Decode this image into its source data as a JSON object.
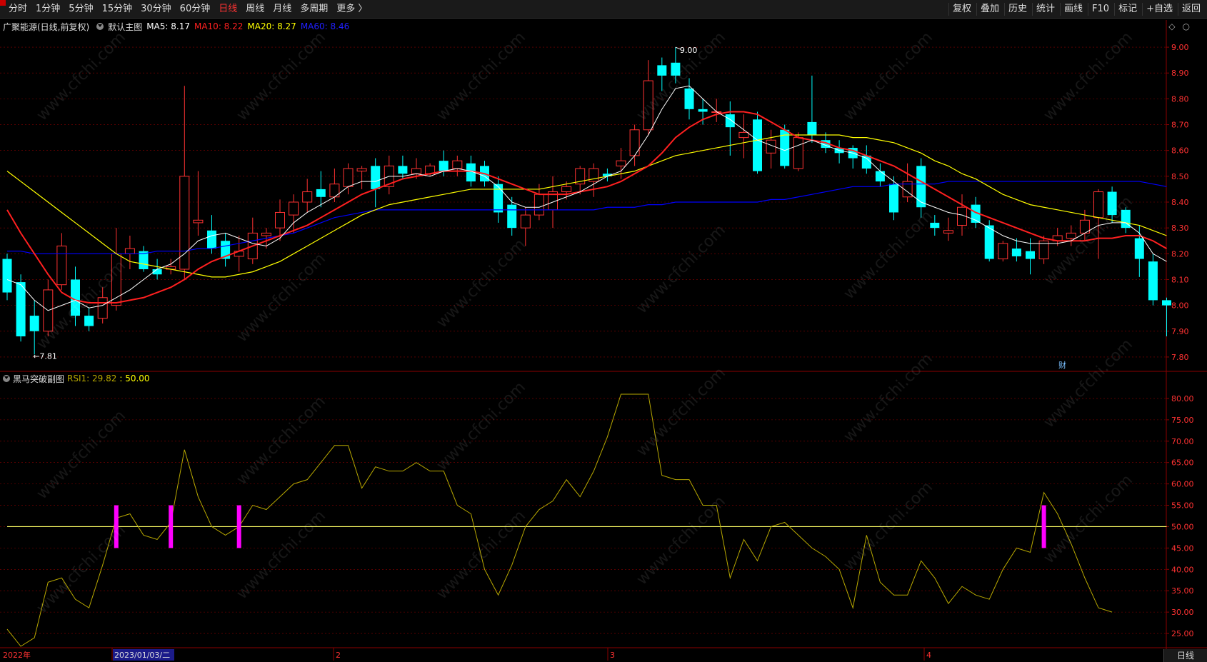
{
  "toolbar": {
    "left": [
      "分时",
      "1分钟",
      "5分钟",
      "15分钟",
      "30分钟",
      "60分钟",
      "日线",
      "周线",
      "月线",
      "多周期",
      "更多 〉"
    ],
    "active_index": 6,
    "right": [
      "复权",
      "叠加",
      "历史",
      "统计",
      "画线",
      "F10",
      "标记",
      "+自选",
      "返回"
    ]
  },
  "main_info": {
    "stock": "广聚能源(日线,前复权)",
    "template": "默认主图",
    "ma5": "MA5: 8.17",
    "ma10": "MA10: 8.22",
    "ma20": "MA20: 8.27",
    "ma60": "MA60: 8.46"
  },
  "sub_info": {
    "name": "黑马突破副图",
    "rsi_label": "RSI1: 29.82",
    "rsi_ref": ": 50.00"
  },
  "colors": {
    "up": "#ff3232",
    "down": "#00ffff",
    "ma5": "#ffffff",
    "ma10": "#ff2020",
    "ma20": "#ffff00",
    "ma60": "#0000ff",
    "rsi": "#b8a800",
    "signal": "#ff00ff",
    "grid": "#8b0000"
  },
  "annotations": {
    "high_label": "9.00",
    "low_label": "←7.81",
    "cai": "财"
  },
  "x_axis": {
    "labels": [
      "2022年",
      "2023/01/03/二",
      "2",
      "3",
      "4"
    ]
  },
  "bottom_right": "日线",
  "watermark": "www.cfchi.com",
  "chart_data": [
    {
      "type": "candlestick",
      "title": "广聚能源(日线,前复权)",
      "ylim": [
        7.75,
        9.05
      ],
      "yticks": [
        "9.00",
        "8.90",
        "8.80",
        "8.70",
        "8.60",
        "8.50",
        "8.40",
        "8.30",
        "8.20",
        "8.10",
        "8.00",
        "7.90",
        "7.80"
      ],
      "ytick_values": [
        9.0,
        8.9,
        8.8,
        8.7,
        8.6,
        8.5,
        8.4,
        8.3,
        8.2,
        8.1,
        8.0,
        7.9,
        7.8
      ],
      "candles": [
        [
          8.18,
          8.05,
          8.2,
          8.02
        ],
        [
          8.09,
          7.88,
          8.12,
          7.86
        ],
        [
          7.96,
          7.9,
          8.02,
          7.81
        ],
        [
          7.9,
          8.06,
          8.1,
          7.88
        ],
        [
          8.08,
          8.23,
          8.28,
          8.06
        ],
        [
          8.1,
          7.96,
          8.15,
          7.92
        ],
        [
          7.96,
          7.92,
          7.99,
          7.9
        ],
        [
          7.95,
          8.03,
          8.07,
          7.93
        ],
        [
          8.0,
          8.2,
          8.3,
          7.98
        ],
        [
          8.2,
          8.22,
          8.27,
          8.14
        ],
        [
          8.21,
          8.14,
          8.23,
          8.13
        ],
        [
          8.14,
          8.12,
          8.18,
          8.1
        ],
        [
          8.14,
          8.15,
          8.18,
          8.12
        ],
        [
          8.14,
          8.5,
          8.85,
          8.1
        ],
        [
          8.32,
          8.33,
          8.52,
          8.27
        ],
        [
          8.29,
          8.22,
          8.35,
          8.2
        ],
        [
          8.25,
          8.18,
          8.28,
          8.15
        ],
        [
          8.19,
          8.21,
          8.27,
          8.13
        ],
        [
          8.18,
          8.28,
          8.34,
          8.16
        ],
        [
          8.27,
          8.28,
          8.3,
          8.22
        ],
        [
          8.3,
          8.36,
          8.41,
          8.25
        ],
        [
          8.35,
          8.4,
          8.43,
          8.28
        ],
        [
          8.4,
          8.44,
          8.49,
          8.36
        ],
        [
          8.45,
          8.42,
          8.52,
          8.38
        ],
        [
          8.42,
          8.47,
          8.53,
          8.4
        ],
        [
          8.46,
          8.53,
          8.55,
          8.43
        ],
        [
          8.52,
          8.53,
          8.54,
          8.45
        ],
        [
          8.54,
          8.45,
          8.57,
          8.38
        ],
        [
          8.46,
          8.54,
          8.58,
          8.43
        ],
        [
          8.54,
          8.51,
          8.58,
          8.49
        ],
        [
          8.51,
          8.53,
          8.57,
          8.49
        ],
        [
          8.51,
          8.54,
          8.55,
          8.5
        ],
        [
          8.56,
          8.52,
          8.6,
          8.5
        ],
        [
          8.53,
          8.56,
          8.58,
          8.5
        ],
        [
          8.55,
          8.48,
          8.58,
          8.46
        ],
        [
          8.54,
          8.48,
          8.56,
          8.46
        ],
        [
          8.47,
          8.36,
          8.5,
          8.32
        ],
        [
          8.39,
          8.3,
          8.42,
          8.27
        ],
        [
          8.3,
          8.35,
          8.38,
          8.23
        ],
        [
          8.35,
          8.43,
          8.47,
          8.33
        ],
        [
          8.37,
          8.44,
          8.5,
          8.3
        ],
        [
          8.44,
          8.46,
          8.48,
          8.41
        ],
        [
          8.47,
          8.53,
          8.54,
          8.43
        ],
        [
          8.48,
          8.53,
          8.55,
          8.42
        ],
        [
          8.51,
          8.5,
          8.53,
          8.48
        ],
        [
          8.54,
          8.56,
          8.61,
          8.49
        ],
        [
          8.58,
          8.68,
          8.7,
          8.54
        ],
        [
          8.68,
          8.87,
          8.95,
          8.66
        ],
        [
          8.93,
          8.89,
          8.96,
          8.83
        ],
        [
          8.94,
          8.89,
          9.0,
          8.86
        ],
        [
          8.84,
          8.76,
          8.88,
          8.72
        ],
        [
          8.76,
          8.75,
          8.8,
          8.7
        ],
        [
          8.75,
          8.75,
          8.8,
          8.71
        ],
        [
          8.74,
          8.69,
          8.79,
          8.58
        ],
        [
          8.65,
          8.67,
          8.74,
          8.57
        ],
        [
          8.72,
          8.52,
          8.75,
          8.51
        ],
        [
          8.59,
          8.64,
          8.68,
          8.53
        ],
        [
          8.68,
          8.54,
          8.7,
          8.53
        ],
        [
          8.53,
          8.65,
          8.67,
          8.52
        ],
        [
          8.71,
          8.66,
          8.89,
          8.63
        ],
        [
          8.64,
          8.61,
          8.67,
          8.59
        ],
        [
          8.61,
          8.59,
          8.64,
          8.55
        ],
        [
          8.61,
          8.57,
          8.62,
          8.53
        ],
        [
          8.58,
          8.53,
          8.62,
          8.51
        ],
        [
          8.52,
          8.48,
          8.55,
          8.46
        ],
        [
          8.47,
          8.36,
          8.5,
          8.33
        ],
        [
          8.42,
          8.48,
          8.55,
          8.4
        ],
        [
          8.54,
          8.38,
          8.57,
          8.34
        ],
        [
          8.32,
          8.3,
          8.35,
          8.27
        ],
        [
          8.28,
          8.29,
          8.34,
          8.25
        ],
        [
          8.31,
          8.38,
          8.43,
          8.27
        ],
        [
          8.39,
          8.32,
          8.42,
          8.3
        ],
        [
          8.31,
          8.18,
          8.33,
          8.17
        ],
        [
          8.18,
          8.24,
          8.25,
          8.17
        ],
        [
          8.22,
          8.19,
          8.26,
          8.17
        ],
        [
          8.21,
          8.18,
          8.26,
          8.12
        ],
        [
          8.18,
          8.25,
          8.27,
          8.16
        ],
        [
          8.25,
          8.27,
          8.3,
          8.23
        ],
        [
          8.26,
          8.28,
          8.31,
          8.23
        ],
        [
          8.28,
          8.33,
          8.37,
          8.25
        ],
        [
          8.34,
          8.44,
          8.45,
          8.18
        ],
        [
          8.44,
          8.35,
          8.46,
          8.32
        ],
        [
          8.37,
          8.3,
          8.38,
          8.28
        ],
        [
          8.26,
          8.18,
          8.31,
          8.11
        ],
        [
          8.17,
          8.02,
          8.2,
          8.0
        ],
        [
          8.02,
          8.0,
          8.03,
          7.88
        ]
      ],
      "ma5": [
        8.1,
        8.08,
        8.02,
        7.98,
        8.0,
        8.02,
        7.99,
        8.0,
        8.03,
        8.06,
        8.1,
        8.14,
        8.16,
        8.2,
        8.25,
        8.27,
        8.28,
        8.26,
        8.24,
        8.23,
        8.26,
        8.32,
        8.36,
        8.39,
        8.42,
        8.46,
        8.48,
        8.48,
        8.5,
        8.5,
        8.51,
        8.5,
        8.52,
        8.53,
        8.52,
        8.5,
        8.46,
        8.4,
        8.38,
        8.38,
        8.4,
        8.42,
        8.44,
        8.47,
        8.5,
        8.52,
        8.58,
        8.66,
        8.76,
        8.84,
        8.85,
        8.8,
        8.75,
        8.72,
        8.68,
        8.64,
        8.62,
        8.6,
        8.62,
        8.64,
        8.62,
        8.6,
        8.59,
        8.57,
        8.52,
        8.48,
        8.44,
        8.4,
        8.38,
        8.36,
        8.35,
        8.33,
        8.3,
        8.27,
        8.25,
        8.24,
        8.24,
        8.24,
        8.25,
        8.28,
        8.31,
        8.32,
        8.32,
        8.28,
        8.2,
        8.17
      ],
      "ma10": [
        8.37,
        8.28,
        8.2,
        8.12,
        8.05,
        8.02,
        8.01,
        8.01,
        8.01,
        8.02,
        8.03,
        8.05,
        8.07,
        8.1,
        8.14,
        8.17,
        8.19,
        8.21,
        8.23,
        8.25,
        8.27,
        8.29,
        8.31,
        8.34,
        8.37,
        8.4,
        8.43,
        8.45,
        8.47,
        8.49,
        8.5,
        8.51,
        8.52,
        8.52,
        8.52,
        8.51,
        8.49,
        8.47,
        8.45,
        8.43,
        8.43,
        8.43,
        8.44,
        8.45,
        8.46,
        8.48,
        8.51,
        8.54,
        8.59,
        8.65,
        8.69,
        8.72,
        8.74,
        8.75,
        8.75,
        8.74,
        8.71,
        8.68,
        8.65,
        8.64,
        8.63,
        8.61,
        8.6,
        8.58,
        8.56,
        8.54,
        8.51,
        8.48,
        8.45,
        8.42,
        8.39,
        8.36,
        8.34,
        8.32,
        8.3,
        8.28,
        8.26,
        8.25,
        8.25,
        8.25,
        8.26,
        8.26,
        8.27,
        8.27,
        8.25,
        8.22
      ],
      "ma20": [
        8.52,
        8.48,
        8.44,
        8.4,
        8.36,
        8.32,
        8.28,
        8.24,
        8.2,
        8.17,
        8.16,
        8.15,
        8.14,
        8.13,
        8.12,
        8.11,
        8.11,
        8.12,
        8.13,
        8.15,
        8.17,
        8.2,
        8.23,
        8.26,
        8.29,
        8.32,
        8.35,
        8.37,
        8.39,
        8.4,
        8.41,
        8.42,
        8.43,
        8.44,
        8.45,
        8.45,
        8.45,
        8.45,
        8.45,
        8.45,
        8.46,
        8.47,
        8.48,
        8.49,
        8.5,
        8.51,
        8.52,
        8.54,
        8.56,
        8.58,
        8.59,
        8.6,
        8.61,
        8.62,
        8.63,
        8.64,
        8.65,
        8.66,
        8.66,
        8.66,
        8.66,
        8.66,
        8.65,
        8.65,
        8.64,
        8.63,
        8.61,
        8.59,
        8.56,
        8.54,
        8.51,
        8.49,
        8.46,
        8.43,
        8.41,
        8.39,
        8.38,
        8.37,
        8.36,
        8.35,
        8.34,
        8.33,
        8.32,
        8.31,
        8.29,
        8.27
      ],
      "ma60": [
        8.21,
        8.21,
        8.2,
        8.2,
        8.2,
        8.2,
        8.2,
        8.2,
        8.2,
        8.2,
        8.2,
        8.21,
        8.21,
        8.21,
        8.22,
        8.22,
        8.23,
        8.24,
        8.25,
        8.26,
        8.27,
        8.28,
        8.3,
        8.32,
        8.34,
        8.35,
        8.36,
        8.37,
        8.37,
        8.37,
        8.37,
        8.37,
        8.37,
        8.37,
        8.37,
        8.37,
        8.37,
        8.37,
        8.37,
        8.37,
        8.37,
        8.37,
        8.37,
        8.37,
        8.38,
        8.38,
        8.38,
        8.39,
        8.39,
        8.4,
        8.4,
        8.4,
        8.4,
        8.4,
        8.4,
        8.4,
        8.41,
        8.41,
        8.42,
        8.43,
        8.44,
        8.45,
        8.46,
        8.46,
        8.46,
        8.47,
        8.47,
        8.47,
        8.47,
        8.48,
        8.48,
        8.48,
        8.48,
        8.48,
        8.48,
        8.48,
        8.48,
        8.48,
        8.48,
        8.48,
        8.48,
        8.48,
        8.48,
        8.48,
        8.47,
        8.46
      ]
    },
    {
      "type": "line",
      "title": "黑马突破副图",
      "ylim": [
        22,
        83
      ],
      "yticks": [
        "80.00",
        "75.00",
        "70.00",
        "65.00",
        "60.00",
        "55.00",
        "50.00",
        "45.00",
        "40.00",
        "35.00",
        "30.00",
        "25.00"
      ],
      "ytick_values": [
        80,
        75,
        70,
        65,
        60,
        55,
        50,
        45,
        40,
        35,
        30,
        25
      ],
      "reference": 50.0,
      "rsi": [
        26,
        22,
        24,
        37,
        38,
        33,
        31,
        41,
        52,
        53,
        48,
        47,
        51,
        68,
        57,
        50,
        48,
        50,
        55,
        54,
        57,
        60,
        61,
        65,
        69,
        69,
        59,
        64,
        63,
        63,
        65,
        63,
        63,
        55,
        53,
        40,
        34,
        41,
        50,
        54,
        56,
        61,
        57,
        63,
        71,
        81,
        81,
        81,
        62,
        61,
        61,
        55,
        55,
        38,
        47,
        42,
        50,
        51,
        48,
        45,
        43,
        40,
        31,
        48,
        37,
        34,
        34,
        42,
        38,
        32,
        36,
        34,
        33,
        40,
        45,
        44,
        58,
        53,
        46,
        38,
        31,
        30
      ],
      "signals_at": [
        8,
        12,
        17,
        76
      ]
    }
  ]
}
